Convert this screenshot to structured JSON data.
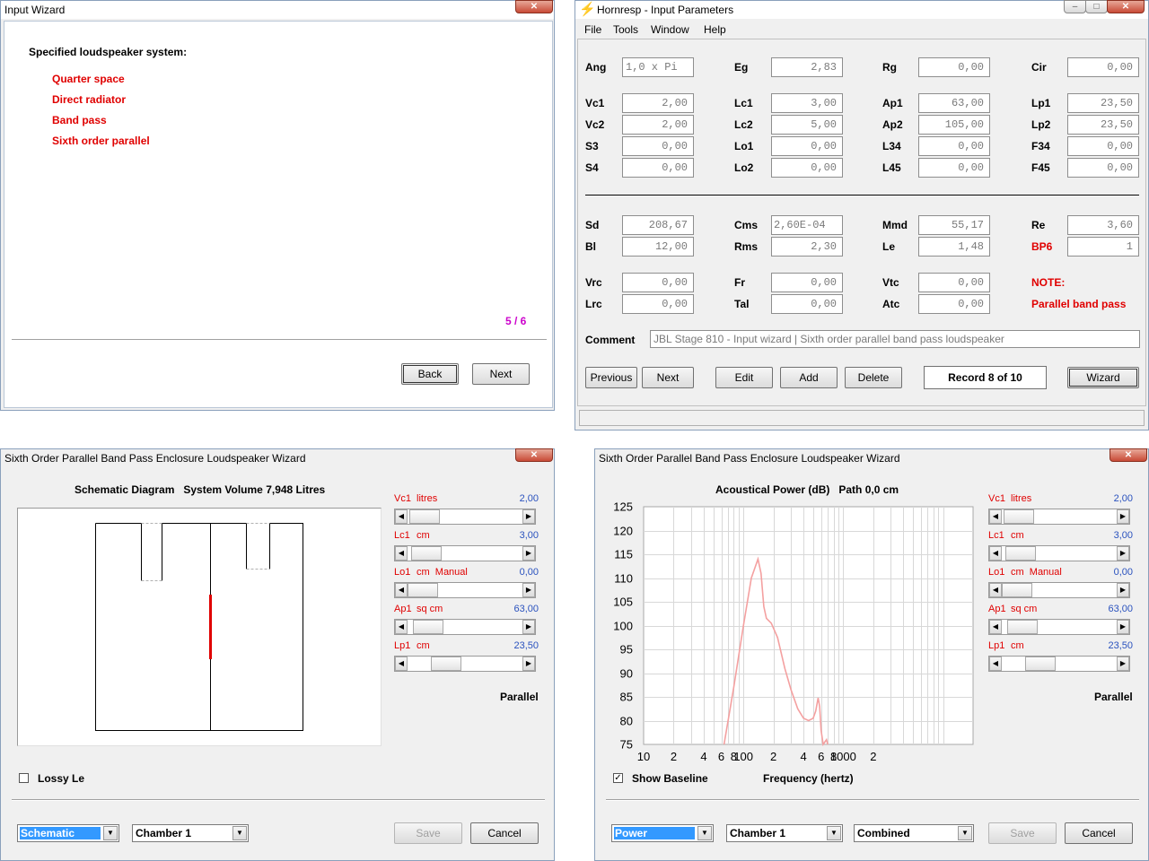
{
  "input_wizard": {
    "title": "Input Wizard",
    "heading": "Specified loudspeaker system:",
    "items": [
      "Quarter space",
      "Direct radiator",
      "Band pass",
      "Sixth order parallel"
    ],
    "page": "5 / 6",
    "back_label": "Back",
    "next_label": "Next"
  },
  "params": {
    "title": "Hornresp - Input Parameters",
    "menu": [
      "File",
      "Tools",
      "Window",
      "Help"
    ],
    "fields": [
      {
        "label": "Ang",
        "value": "1,0 x Pi"
      },
      {
        "label": "Eg",
        "value": "2,83"
      },
      {
        "label": "Rg",
        "value": "0,00"
      },
      {
        "label": "Cir",
        "value": "0,00"
      },
      {
        "label": "Vc1",
        "value": "2,00"
      },
      {
        "label": "Lc1",
        "value": "3,00"
      },
      {
        "label": "Ap1",
        "value": "63,00"
      },
      {
        "label": "Lp1",
        "value": "23,50"
      },
      {
        "label": "Vc2",
        "value": "2,00"
      },
      {
        "label": "Lc2",
        "value": "5,00"
      },
      {
        "label": "Ap2",
        "value": "105,00"
      },
      {
        "label": "Lp2",
        "value": "23,50"
      },
      {
        "label": "S3",
        "value": "0,00"
      },
      {
        "label": "Lo1",
        "value": "0,00"
      },
      {
        "label": "L34",
        "value": "0,00"
      },
      {
        "label": "F34",
        "value": "0,00"
      },
      {
        "label": "S4",
        "value": "0,00"
      },
      {
        "label": "Lo2",
        "value": "0,00"
      },
      {
        "label": "L45",
        "value": "0,00"
      },
      {
        "label": "F45",
        "value": "0,00"
      },
      {
        "label": "Sd",
        "value": "208,67"
      },
      {
        "label": "Cms",
        "value": "2,60E-04"
      },
      {
        "label": "Mmd",
        "value": "55,17"
      },
      {
        "label": "Re",
        "value": "3,60"
      },
      {
        "label": "Bl",
        "value": "12,00"
      },
      {
        "label": "Rms",
        "value": "2,30"
      },
      {
        "label": "Le",
        "value": "1,48"
      },
      {
        "label": "BP6",
        "value": "1"
      },
      {
        "label": "Vrc",
        "value": "0,00"
      },
      {
        "label": "Fr",
        "value": "0,00"
      },
      {
        "label": "Vtc",
        "value": "0,00"
      },
      {
        "label": "Lrc",
        "value": "0,00"
      },
      {
        "label": "Tal",
        "value": "0,00"
      },
      {
        "label": "Atc",
        "value": "0,00"
      }
    ],
    "note_label": "NOTE:",
    "note_text": "Parallel band pass",
    "comment_label": "Comment",
    "comment": "JBL Stage 810 - Input wizard | Sixth order parallel band pass loudspeaker",
    "buttons": {
      "previous": "Previous",
      "next": "Next",
      "edit": "Edit",
      "add": "Add",
      "delete": "Delete",
      "wizard": "Wizard"
    },
    "record": "Record 8 of 10"
  },
  "schematic_wizard": {
    "title": "Sixth Order Parallel Band Pass Enclosure Loudspeaker Wizard",
    "heading": "Schematic Diagram   System Volume 7,948 Litres",
    "lossy": "Lossy Le",
    "view": "Schematic",
    "chamber": "Chamber 1",
    "save": "Save",
    "cancel": "Cancel",
    "mode": "Parallel"
  },
  "power_wizard": {
    "title": "Sixth Order Parallel Band Pass Enclosure Loudspeaker Wizard",
    "heading": "Acoustical Power (dB)   Path 0,0 cm",
    "show_baseline": "Show Baseline",
    "xlabel": "Frequency (hertz)",
    "view": "Power",
    "chamber": "Chamber 1",
    "combined": "Combined",
    "save": "Save",
    "cancel": "Cancel",
    "mode": "Parallel"
  },
  "sliders": [
    {
      "name": "Vc1",
      "unit": "litres",
      "value": "2,00",
      "pos": 0.02
    },
    {
      "name": "Lc1",
      "unit": "cm",
      "value": "3,00",
      "pos": 0.04
    },
    {
      "name": "Lo1",
      "unit": "cm  Manual",
      "value": "0,00",
      "pos": 0.0
    },
    {
      "name": "Ap1",
      "unit": "sq cm",
      "value": "63,00",
      "pos": 0.06
    },
    {
      "name": "Lp1",
      "unit": "cm",
      "value": "23,50",
      "pos": 0.28
    }
  ],
  "chart_data": {
    "type": "line",
    "title": "",
    "xlabel": "Frequency (hertz)",
    "ylabel": "",
    "x_scale": "log",
    "xlim": [
      10,
      20000
    ],
    "ylim": [
      75,
      125
    ],
    "x_tick_labels": [
      "10",
      "2",
      "4",
      "6",
      "8",
      "100",
      "2",
      "4",
      "6",
      "8",
      "1000",
      "2"
    ],
    "y_ticks": [
      75,
      80,
      85,
      90,
      95,
      100,
      105,
      110,
      115,
      120,
      125
    ],
    "grid": true,
    "series": [
      {
        "color": "#f4a0a0",
        "x": [
          64,
          80,
          100,
          120,
          140,
          150,
          160,
          170,
          190,
          220,
          260,
          300,
          350,
          400,
          450,
          500,
          530,
          560,
          580,
          600,
          630,
          680,
          700
        ],
        "y": [
          75,
          87,
          100,
          110,
          114,
          111,
          104,
          101.5,
          100.5,
          97.5,
          91,
          86.5,
          82.5,
          80.5,
          80,
          80.5,
          82,
          84.8,
          83,
          78,
          75,
          76,
          75
        ]
      }
    ]
  }
}
